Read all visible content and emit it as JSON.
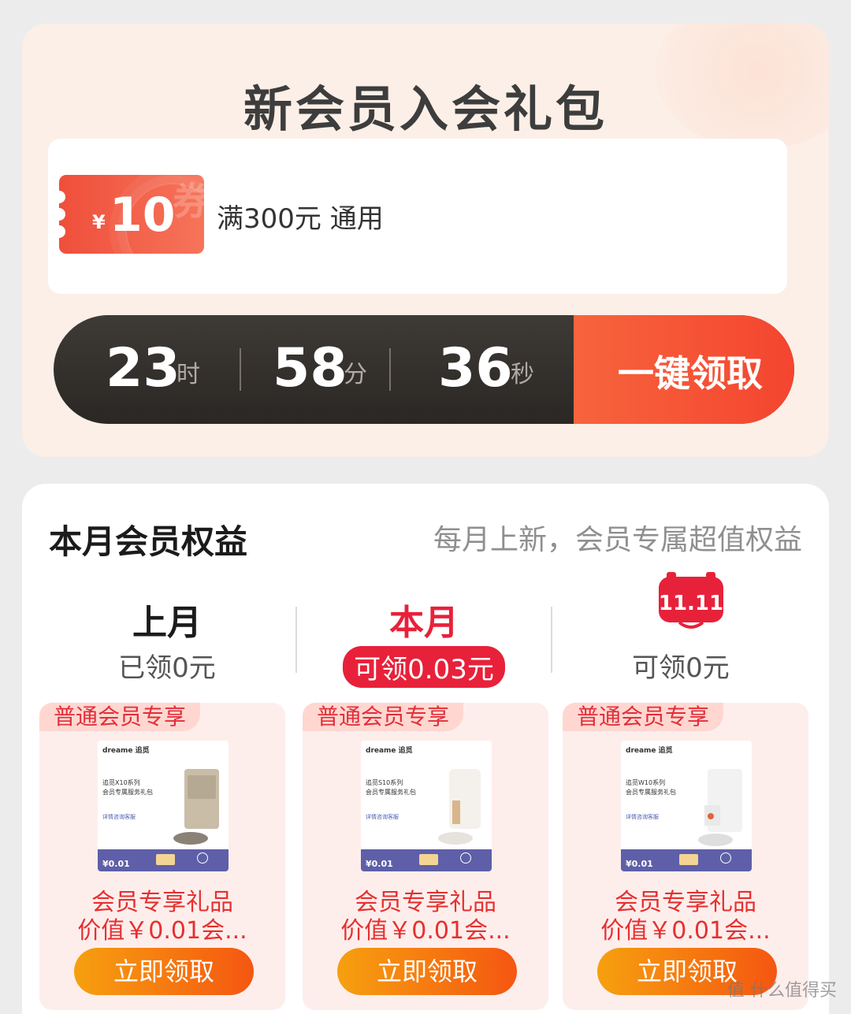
{
  "gift": {
    "title": "新会员入会礼包",
    "coupon": {
      "currency": "¥",
      "amount": "10",
      "watermark": "券",
      "condition": "满300元 通用"
    },
    "countdown": {
      "hours": "23",
      "hours_unit": "时",
      "minutes": "58",
      "minutes_unit": "分",
      "seconds": "36",
      "seconds_unit": "秒"
    },
    "claim_all_label": "一键领取"
  },
  "benefits": {
    "title": "本月会员权益",
    "subtitle": "每月上新，会员专属超值权益",
    "months": [
      {
        "name": "上月",
        "amount": "已领0元"
      },
      {
        "name": "本月",
        "amount": "可领0.03元"
      },
      {
        "badge": "11.11",
        "amount": "可领0元"
      }
    ],
    "gifts": [
      {
        "tag": "普通会员专享",
        "brand": "dreame 追觅",
        "product_line": "追觅X10系列",
        "product_desc": "会员专属服务礼包",
        "detail": "详情咨询客服",
        "img_price": "¥0.01",
        "title": "会员专享礼品",
        "value": "价值￥0.01会...",
        "button": "立即领取"
      },
      {
        "tag": "普通会员专享",
        "brand": "dreame 追觅",
        "product_line": "追觅S10系列",
        "product_desc": "会员专属服务礼包",
        "detail": "详情咨询客服",
        "img_price": "¥0.01",
        "title": "会员专享礼品",
        "value": "价值￥0.01会...",
        "button": "立即领取"
      },
      {
        "tag": "普通会员专享",
        "brand": "dreame 追觅",
        "product_line": "追觅W10系列",
        "product_desc": "会员专属服务礼包",
        "detail": "详情咨询客服",
        "img_price": "¥0.01",
        "title": "会员专享礼品",
        "value": "价值￥0.01会...",
        "button": "立即领取"
      }
    ]
  },
  "watermark": "值 什么值得买",
  "colors": {
    "accent_red": "#e8213a",
    "orange": "#f55611",
    "dark_bar": "#2f2b28"
  }
}
